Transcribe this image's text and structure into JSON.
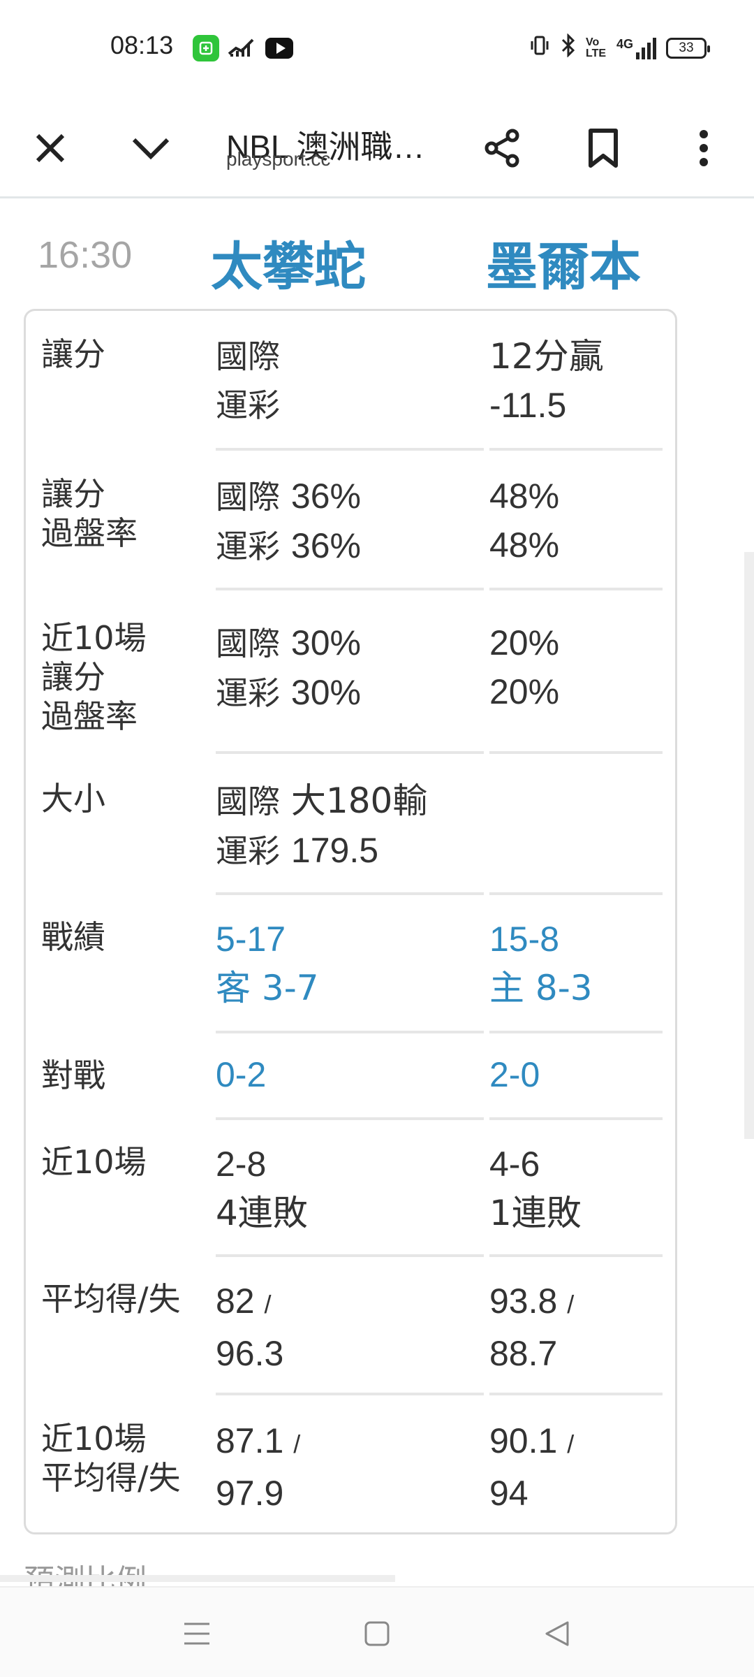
{
  "status_bar": {
    "time": "08:13",
    "icons": [
      "app-icon",
      "signal-icon",
      "youtube-icon",
      "vibrate-icon",
      "bluetooth-icon",
      "volte-icon",
      "4g-signal-icon",
      "battery-icon"
    ],
    "volte": "Vo LTE",
    "network": "4G",
    "battery": "33"
  },
  "toolbar": {
    "title": "NBL 澳洲職…",
    "url": "playsport.cc",
    "icons": [
      "close-icon",
      "chevron-down-icon",
      "share-icon",
      "bookmark-icon",
      "more-vert-icon"
    ]
  },
  "match": {
    "time": "16:30",
    "home": "太攀蛇",
    "away": "墨爾本"
  },
  "rows": {
    "spread": {
      "label": "讓分",
      "c1_l1": "國際",
      "c1_l2": "運彩",
      "c2_l1": "12分贏",
      "c2_l2": "-11.5"
    },
    "cover_rate": {
      "label_l1": "讓分",
      "label_l2": "過盤率",
      "c1_l1_tag": "國際",
      "c1_l1_val": "36%",
      "c1_l2_tag": "運彩",
      "c1_l2_val": "36%",
      "c2_l1": "48%",
      "c2_l2": "48%"
    },
    "recent_cover": {
      "label_l1": "近10場",
      "label_l2": "讓分",
      "label_l3": "過盤率",
      "c1_l1_tag": "國際",
      "c1_l1_val": "30%",
      "c1_l2_tag": "運彩",
      "c1_l2_val": "30%",
      "c2_l1": "20%",
      "c2_l2": "20%"
    },
    "total": {
      "label": "大小",
      "c1_l1_tag": "國際",
      "c1_l1_val": "大180輸",
      "c1_l2_tag": "運彩",
      "c1_l2_val": "179.5"
    },
    "record": {
      "label": "戰績",
      "c1_l1": "5-17",
      "c1_l2": "客 3-7",
      "c2_l1": "15-8",
      "c2_l2": "主 8-3"
    },
    "h2h": {
      "label": "對戰",
      "c1": "0-2",
      "c2": "2-0"
    },
    "last10": {
      "label": "近10場",
      "c1_l1": "2-8",
      "c1_l2": "4連敗",
      "c2_l1": "4-6",
      "c2_l2": "1連敗"
    },
    "avg_pts": {
      "label": "平均得/失",
      "c1_l1": "82",
      "c1_l2": "96.3",
      "c2_l1": "93.8",
      "c2_l2": "88.7",
      "slash": "/"
    },
    "recent_avg": {
      "label_l1": "近10場",
      "label_l2": "平均得/失",
      "c1_l1": "87.1",
      "c1_l2": "97.9",
      "c2_l1": "90.1",
      "c2_l2": "94",
      "slash": "/"
    }
  },
  "next_section": "預測比例",
  "nav": {
    "icons": [
      "menu-icon",
      "home-icon",
      "back-icon"
    ]
  }
}
